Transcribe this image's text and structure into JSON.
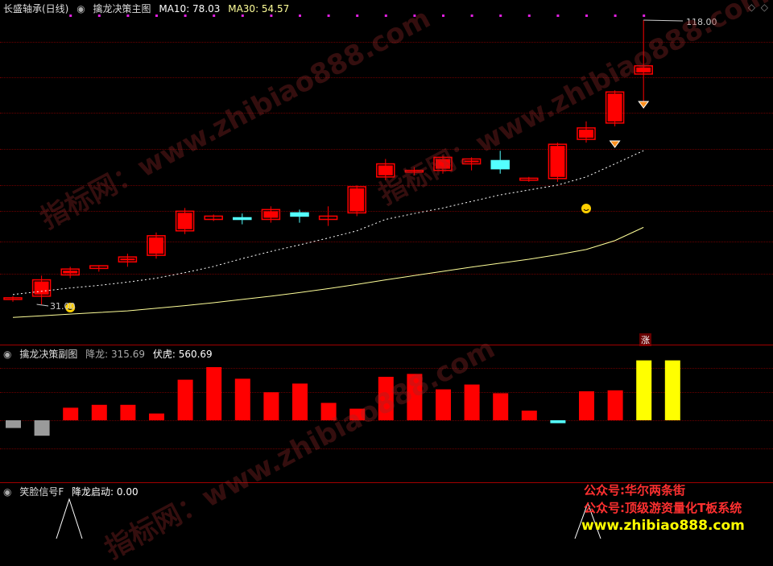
{
  "main_panel": {
    "stock_name": "长盛轴承(日线)",
    "indicator_name": "擒龙决策主图",
    "ma10_label": "MA10: 78.03",
    "ma30_label": "MA30: 54.57",
    "high_label": "118.00",
    "low_label": "31.00",
    "zhang_badge": "涨"
  },
  "sub_panel": {
    "indicator_name": "擒龙决策副图",
    "xianglong_label": "降龙: 315.69",
    "fuhu_label": "伏虎: 560.69"
  },
  "signal_panel": {
    "indicator_name": "笑脸信号F",
    "start_label": "降龙启动: 0.00"
  },
  "watermark": {
    "text1": "指标网：www.zhibiao888.com",
    "text2": "指标网：www.zhibiao888.com",
    "text3": "指标网：www.zhibiao888.com"
  },
  "ads": {
    "line1": "公众号:华尔两条街",
    "line2": "公众号:顶级游资量化T板系统",
    "line3": "www.zhibiao888.com"
  },
  "colors": {
    "up": "#ff0000",
    "down": "#54ffff",
    "ma10": "#ffffff",
    "ma30": "#ffff99",
    "yellow": "#ffff00",
    "bg": "#000000"
  },
  "chart_data": {
    "type": "candlestick",
    "candles": [
      {
        "o": 32.5,
        "h": 33.5,
        "l": 31.8,
        "c": 33.0
      },
      {
        "o": 33.5,
        "h": 39.8,
        "l": 31.0,
        "c": 38.5
      },
      {
        "o": 40.0,
        "h": 42.5,
        "l": 39.0,
        "c": 41.8
      },
      {
        "o": 42.0,
        "h": 43.0,
        "l": 41.0,
        "c": 42.8
      },
      {
        "o": 44.0,
        "h": 46.5,
        "l": 42.5,
        "c": 45.5
      },
      {
        "o": 46.0,
        "h": 53.0,
        "l": 45.0,
        "c": 52.0
      },
      {
        "o": 53.5,
        "h": 60.5,
        "l": 52.5,
        "c": 59.5
      },
      {
        "o": 57.0,
        "h": 58.5,
        "l": 56.5,
        "c": 58.0
      },
      {
        "o": 57.5,
        "h": 58.8,
        "l": 55.5,
        "c": 57.0
      },
      {
        "o": 57.0,
        "h": 61.0,
        "l": 56.0,
        "c": 60.0
      },
      {
        "o": 59.0,
        "h": 60.0,
        "l": 56.0,
        "c": 58.0
      },
      {
        "o": 57.0,
        "h": 61.0,
        "l": 55.0,
        "c": 58.0
      },
      {
        "o": 59.0,
        "h": 67.5,
        "l": 58.0,
        "c": 67.0
      },
      {
        "o": 70.0,
        "h": 75.5,
        "l": 69.0,
        "c": 74.0
      },
      {
        "o": 71.5,
        "h": 73.0,
        "l": 70.5,
        "c": 72.0
      },
      {
        "o": 72.0,
        "h": 76.5,
        "l": 71.0,
        "c": 76.0
      },
      {
        "o": 74.0,
        "h": 76.0,
        "l": 72.0,
        "c": 75.5
      },
      {
        "o": 75.0,
        "h": 78.0,
        "l": 71.0,
        "c": 72.5
      },
      {
        "o": 69.0,
        "h": 70.0,
        "l": 68.5,
        "c": 69.6
      },
      {
        "o": 69.5,
        "h": 80.5,
        "l": 68.5,
        "c": 80.0
      },
      {
        "o": 81.5,
        "h": 87.0,
        "l": 80.5,
        "c": 85.0
      },
      {
        "o": 86.5,
        "h": 96.5,
        "l": 85.5,
        "c": 96.0
      },
      {
        "o": 101.5,
        "h": 118.0,
        "l": 91.0,
        "c": 104.0
      }
    ],
    "ma10": [
      34.0,
      35.0,
      36.0,
      36.8,
      37.8,
      39.0,
      40.7,
      42.6,
      45.0,
      47.2,
      49.2,
      51.3,
      53.5,
      57.0,
      58.8,
      60.5,
      62.5,
      64.5,
      66.0,
      67.5,
      70.0,
      74.0,
      78.03
    ],
    "ma30": [
      27.0,
      27.5,
      28.0,
      28.5,
      29.0,
      29.8,
      30.6,
      31.5,
      32.5,
      33.5,
      34.6,
      35.8,
      37.1,
      38.5,
      39.8,
      41.1,
      42.4,
      43.6,
      44.8,
      46.2,
      47.8,
      50.5,
      54.57
    ],
    "sub_bars": [
      {
        "v": -0.8,
        "c": "gray"
      },
      {
        "v": -1.6,
        "c": "gray"
      },
      {
        "v": 1.3,
        "c": "red"
      },
      {
        "v": 1.6,
        "c": "red"
      },
      {
        "v": 1.6,
        "c": "red"
      },
      {
        "v": 0.7,
        "c": "red"
      },
      {
        "v": 4.2,
        "c": "red"
      },
      {
        "v": 5.5,
        "c": "red"
      },
      {
        "v": 4.3,
        "c": "red"
      },
      {
        "v": 2.9,
        "c": "red"
      },
      {
        "v": 3.8,
        "c": "red"
      },
      {
        "v": 1.8,
        "c": "red"
      },
      {
        "v": 1.2,
        "c": "red"
      },
      {
        "v": 4.5,
        "c": "red"
      },
      {
        "v": 4.8,
        "c": "red"
      },
      {
        "v": 3.2,
        "c": "red"
      },
      {
        "v": 3.7,
        "c": "red"
      },
      {
        "v": 2.8,
        "c": "red"
      },
      {
        "v": 1.0,
        "c": "red"
      },
      {
        "v": -0.3,
        "c": "cyan"
      },
      {
        "v": 3.0,
        "c": "red"
      },
      {
        "v": 3.1,
        "c": "red"
      },
      {
        "v": 6.2,
        "c": "yellow"
      },
      {
        "v": 6.2,
        "c": "yellow"
      }
    ]
  }
}
